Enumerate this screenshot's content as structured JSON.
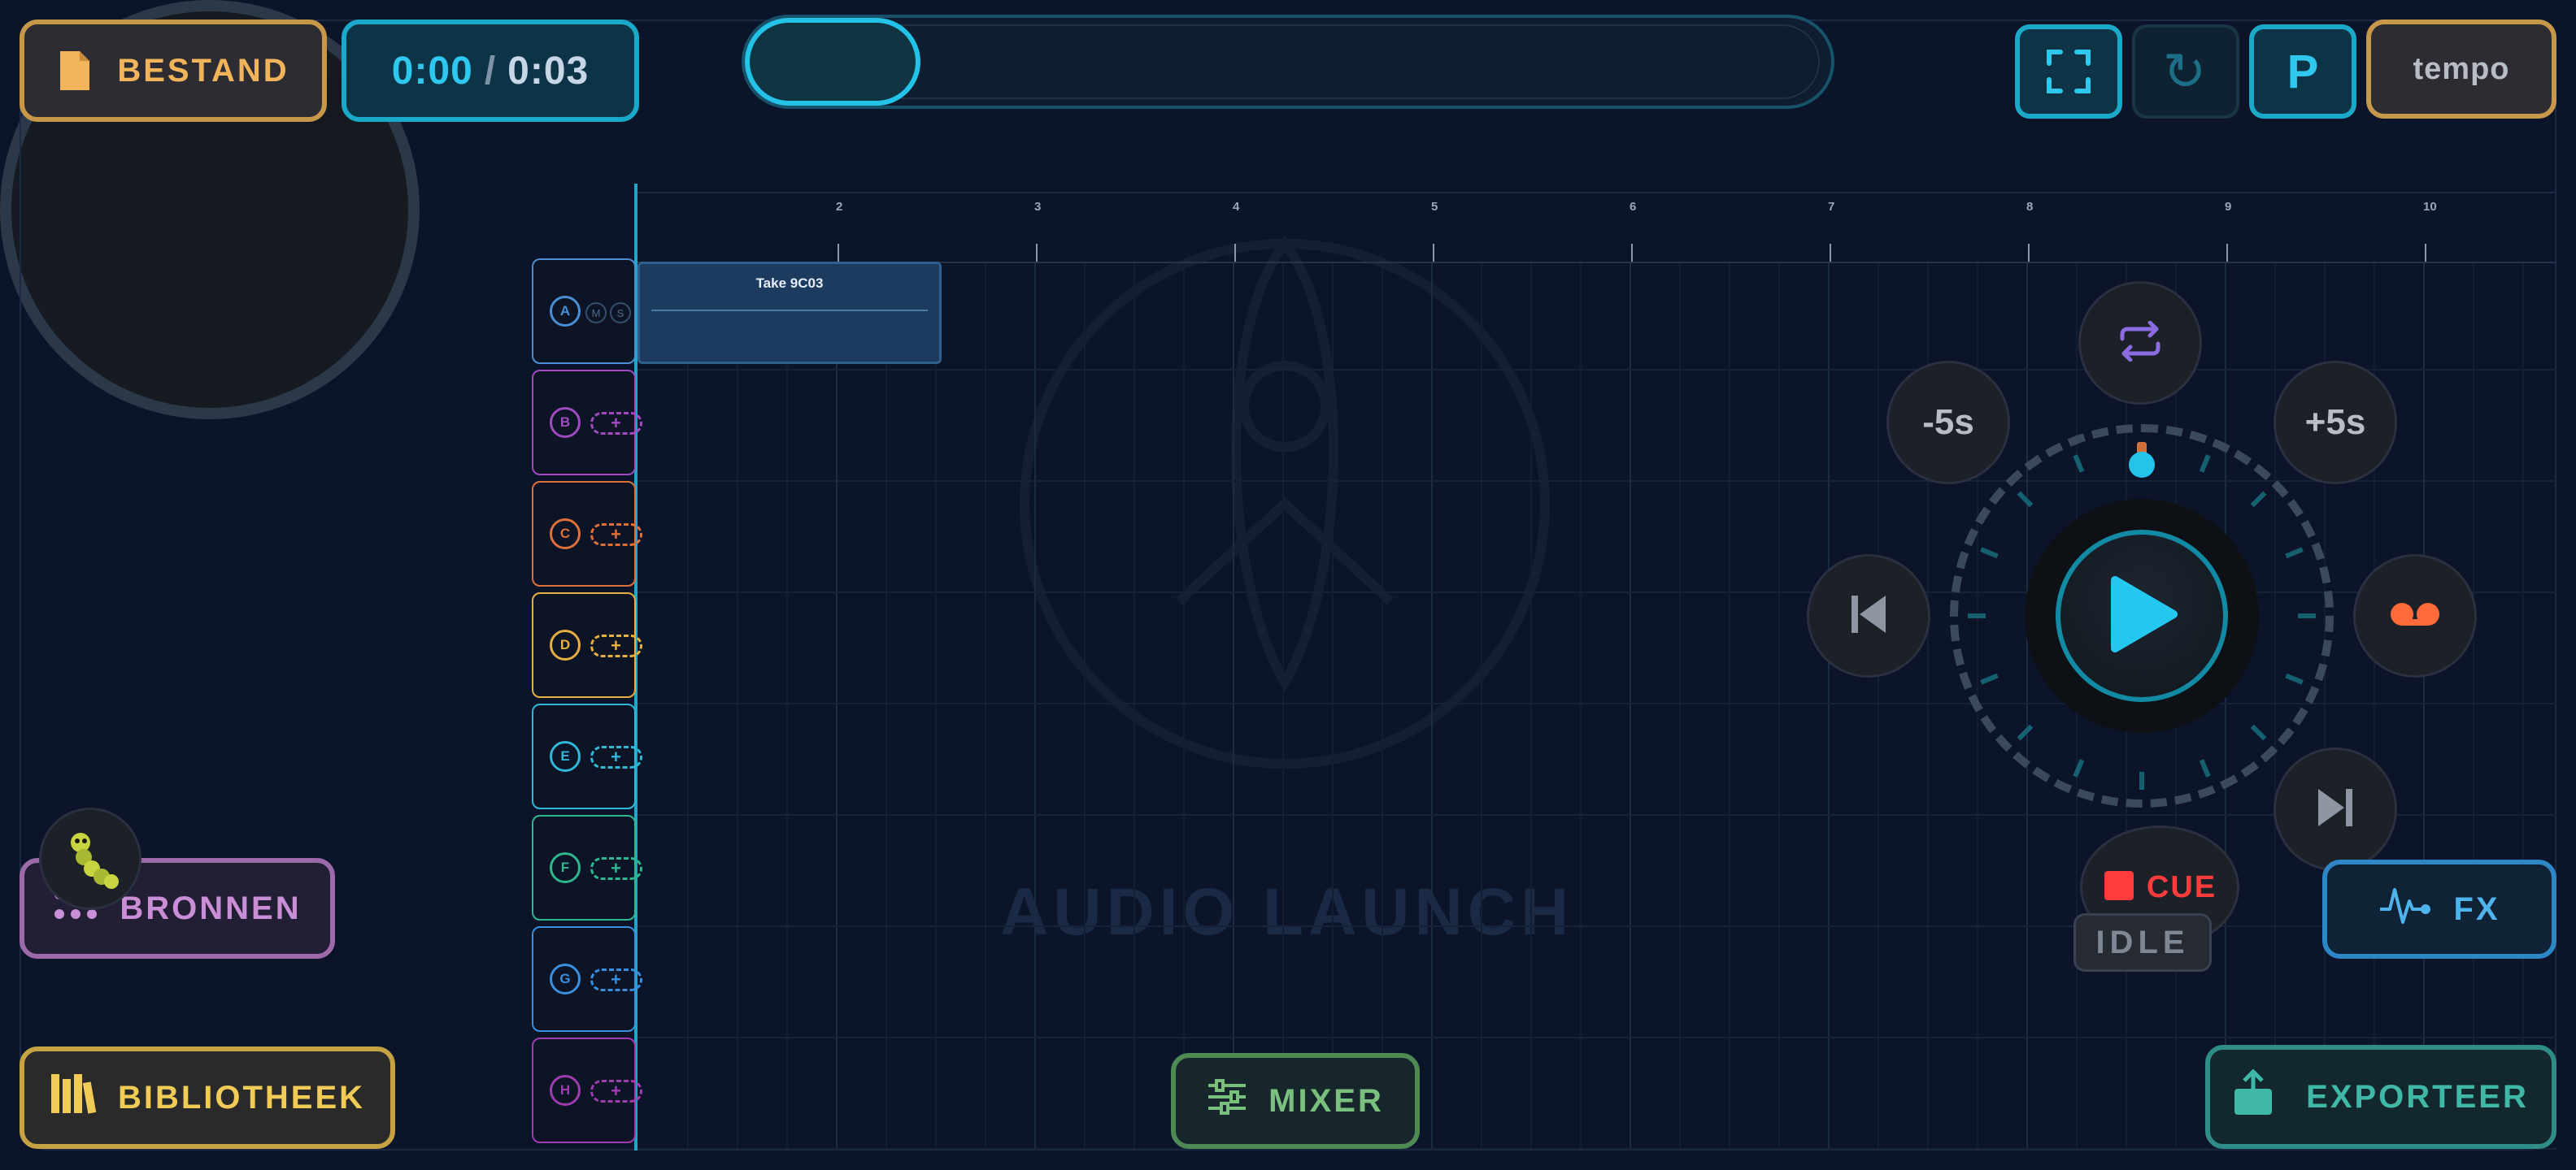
{
  "toolbar": {
    "file_label": "BESTAND",
    "time_current": "0:00",
    "time_separator": "/",
    "time_total": "0:03",
    "preset_label": "P",
    "tempo_label": "tempo",
    "loop_glyph": "↻"
  },
  "ruler": {
    "bars": [
      "2",
      "3",
      "4",
      "5",
      "6",
      "7",
      "8",
      "9",
      "10"
    ]
  },
  "tracks": [
    {
      "letter": "A",
      "color": "#4a8fd6",
      "mute": "M",
      "solo": "S"
    },
    {
      "letter": "B",
      "color": "#a04ac0"
    },
    {
      "letter": "C",
      "color": "#e0703a"
    },
    {
      "letter": "D",
      "color": "#e6b040"
    },
    {
      "letter": "E",
      "color": "#2fb8d8"
    },
    {
      "letter": "F",
      "color": "#2fb890"
    },
    {
      "letter": "G",
      "color": "#3a90e0"
    },
    {
      "letter": "H",
      "color": "#a03cb0"
    }
  ],
  "track_add_glyph": "+",
  "clip": {
    "name": "Take 9C03"
  },
  "transport": {
    "back5_label": "-5s",
    "fwd5_label": "+5s",
    "cue_label": "CUE",
    "status_label": "IDLE",
    "icons": [
      "loop-icon",
      "skip-back-icon",
      "play-icon",
      "record-icon",
      "skip-forward-icon",
      "stop-icon"
    ]
  },
  "watermark": {
    "text": "AUDIO LAUNCH"
  },
  "panels": {
    "sources_label": "BRONNEN",
    "library_label": "BIBLIOTHEEK",
    "mixer_label": "MIXER",
    "fx_label": "FX",
    "export_label": "EXPORTEER"
  },
  "colors": {
    "accent": "#23c3e8",
    "background": "#0b1428",
    "file": "#f1b45a",
    "library": "#f0cb55",
    "sources": "#c98ed6",
    "mixer": "#79c07e",
    "fx": "#4fb3ec",
    "export": "#40b8a8",
    "cue": "#ff3b3b",
    "record": "#ff6a3a"
  }
}
